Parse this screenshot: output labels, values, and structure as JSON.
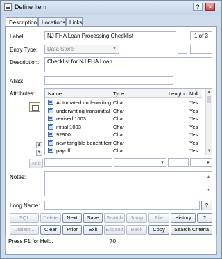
{
  "window": {
    "title": "Define Item",
    "help_btn": "?",
    "close_btn": "✕"
  },
  "tabs": [
    "Description",
    "Locations",
    "Links"
  ],
  "form": {
    "label_lbl": "Label:",
    "label_value": "NJ FHA Loan Processing Checklist",
    "counter": "1 of 3",
    "entry_type_lbl": "Entry Type:",
    "entry_type_value": "Data Store",
    "description_lbl": "Description:",
    "description_value": "Checklist for NJ FHA Loan",
    "alias_lbl": "Alias:",
    "alias_value": "",
    "attributes_lbl": "Attributes:",
    "add_btn": "Add",
    "notes_lbl": "Notes:",
    "long_name_lbl": "Long Name:",
    "long_name_value": "",
    "long_name_btn": "?"
  },
  "attributes": {
    "columns": [
      "Name",
      "Type",
      "Length",
      "Null"
    ],
    "rows": [
      {
        "name": "Automated underwriting",
        "type": "Char",
        "length": "",
        "null": "Yes"
      },
      {
        "name": "underwriting transmittal",
        "type": "Char",
        "length": "",
        "null": "Yes"
      },
      {
        "name": "revised 1003",
        "type": "Char",
        "length": "",
        "null": "Yes"
      },
      {
        "name": "initial 1003",
        "type": "Char",
        "length": "",
        "null": "Yes"
      },
      {
        "name": "92900",
        "type": "Char",
        "length": "",
        "null": "Yes"
      },
      {
        "name": "new tangible benefit form",
        "type": "Char",
        "length": "",
        "null": "Yes"
      },
      {
        "name": "payoff",
        "type": "Char",
        "length": "",
        "null": "Yes"
      }
    ]
  },
  "buttons_row1": [
    "SQL",
    "Delete",
    "Next",
    "Save",
    "Search",
    "Jump",
    "File",
    "History",
    "?"
  ],
  "buttons_row2": [
    "Dialect...",
    "Clear",
    "Prior",
    "Exit",
    "Expand",
    "Back",
    "Copy",
    "Search Criteria"
  ],
  "status": {
    "text": "Press F1 for Help.",
    "count": "70"
  }
}
